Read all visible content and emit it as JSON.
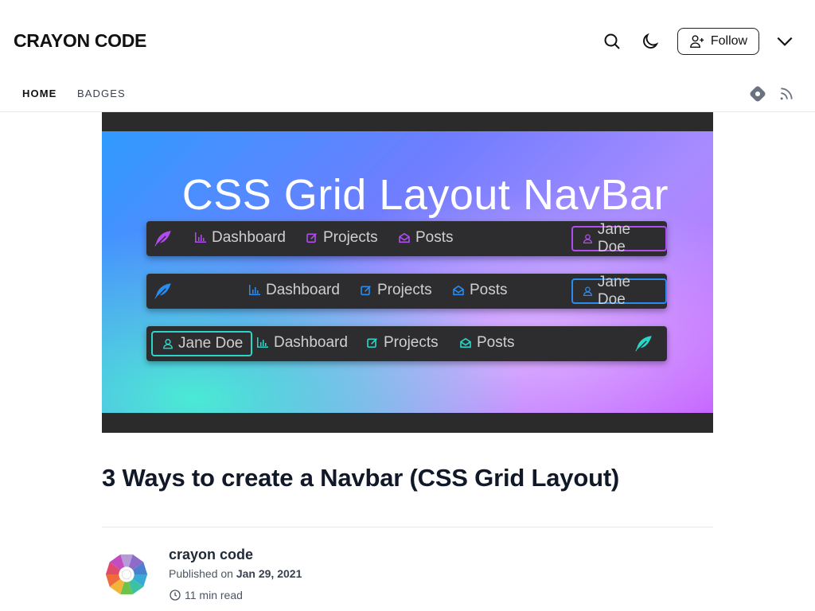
{
  "header": {
    "brand": "CRAYON CODE",
    "follow_label": "Follow",
    "icons": [
      "search-icon",
      "moon-icon",
      "user-plus-icon",
      "chevron-down-icon"
    ]
  },
  "subnav": {
    "items": [
      {
        "label": "HOME",
        "active": true
      },
      {
        "label": "BADGES",
        "active": false
      }
    ],
    "right_icons": [
      "hashnode-icon",
      "rss-icon"
    ]
  },
  "cover": {
    "title": "CSS Grid Layout NavBar",
    "nav_variants": [
      {
        "accent": "#b14cf0",
        "links": [
          "Dashboard",
          "Projects",
          "Posts"
        ],
        "user": "Jane Doe"
      },
      {
        "accent": "#2a8cf0",
        "links": [
          "Dashboard",
          "Projects",
          "Posts"
        ],
        "user": "Jane Doe"
      },
      {
        "accent": "#2ad6c8",
        "links": [
          "Dashboard",
          "Projects",
          "Posts"
        ],
        "user": "Jane Doe"
      }
    ]
  },
  "article": {
    "title": "3 Ways to create a Navbar (CSS Grid Layout)",
    "author": "crayon code",
    "published_prefix": "Published on",
    "published_date": "Jan 29, 2021",
    "read_time": "11 min read"
  },
  "colors": {
    "text": "#111827",
    "muted": "#4b5563",
    "divider": "#e5e7eb"
  }
}
